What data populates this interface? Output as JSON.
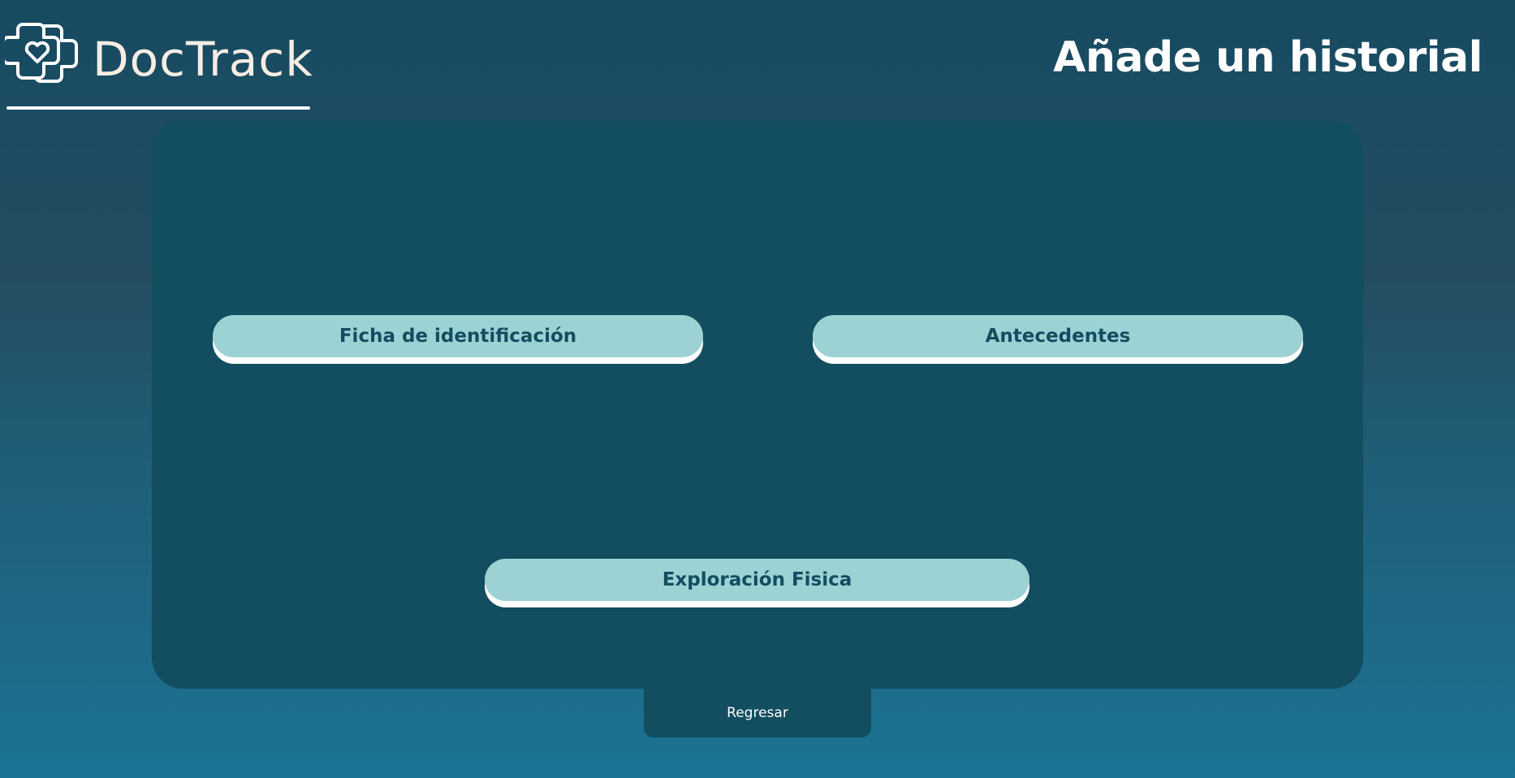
{
  "header": {
    "logo_text": "DocTrack",
    "logo_icon": "medical-cross-heart-icon",
    "page_title": "Añade un historial"
  },
  "main": {
    "sections": [
      {
        "label": "Ficha de identificación"
      },
      {
        "label": "Antecedentes"
      },
      {
        "label": "Exploración Fisica"
      }
    ]
  },
  "footer": {
    "back_label": "Regresar"
  },
  "colors": {
    "panel": "#134d60",
    "button_fill": "#9dd2d5",
    "button_text": "#134d60",
    "logo_text": "#f7ede2",
    "title_text": "#ffffff"
  }
}
